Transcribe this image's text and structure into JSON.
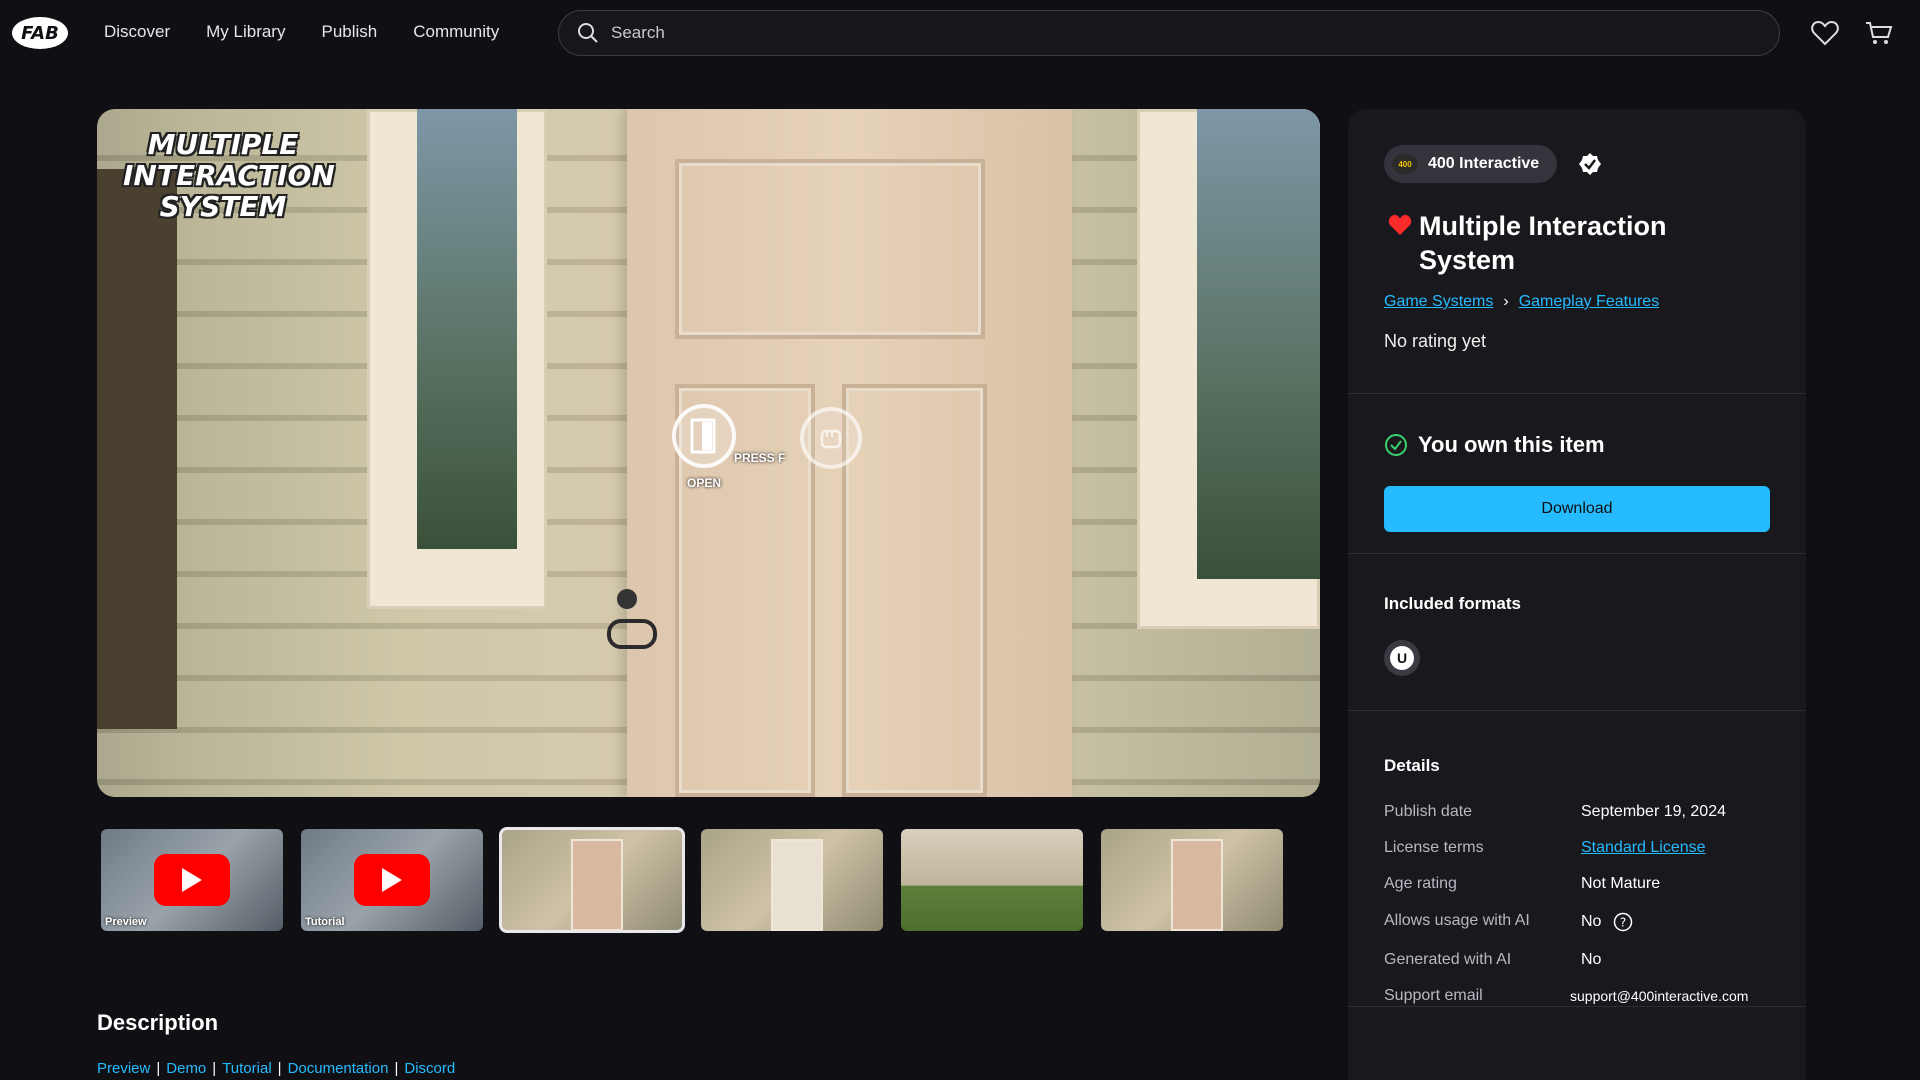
{
  "nav": {
    "logo_text": "FAB",
    "items": [
      "Discover",
      "My Library",
      "Publish",
      "Community"
    ]
  },
  "search": {
    "placeholder": "Search"
  },
  "hero": {
    "overlay_title": [
      "MULTIPLE",
      "INTERACTION",
      "SYSTEM"
    ],
    "press_hint": "PRESS F",
    "open_hint": "OPEN"
  },
  "thumbnails": [
    {
      "label": "Preview",
      "type": "video"
    },
    {
      "label": "Tutorial",
      "type": "video"
    },
    {
      "label": "",
      "type": "image"
    },
    {
      "label": "",
      "type": "image"
    },
    {
      "label": "",
      "type": "image"
    },
    {
      "label": "",
      "type": "image"
    }
  ],
  "description": {
    "heading": "Description",
    "links": [
      "Preview",
      "Demo",
      "Tutorial",
      "Documentation",
      "Discord"
    ]
  },
  "product": {
    "publisher": "400 Interactive",
    "publisher_logo_text": "400",
    "title": "Multiple Interaction System",
    "breadcrumb": [
      "Game Systems",
      "Gameplay Features"
    ],
    "rating": "No rating yet",
    "owned_text": "You own this item",
    "download_label": "Download",
    "formats_heading": "Included formats",
    "format_badge": "U",
    "details_heading": "Details",
    "details": {
      "publish_date_label": "Publish date",
      "publish_date": "September 19, 2024",
      "license_label": "License terms",
      "license": "Standard License",
      "age_label": "Age rating",
      "age": "Not Mature",
      "ai_usage_label": "Allows usage with AI",
      "ai_usage": "No",
      "ai_generated_label": "Generated with AI",
      "ai_generated": "No",
      "support_label": "Support email",
      "support": "support@400interactive.com"
    }
  },
  "colors": {
    "accent": "#26bbff",
    "bg": "#101014",
    "panel": "#18181d",
    "heart": "#ff2b2b",
    "owned": "#3bd16f"
  }
}
